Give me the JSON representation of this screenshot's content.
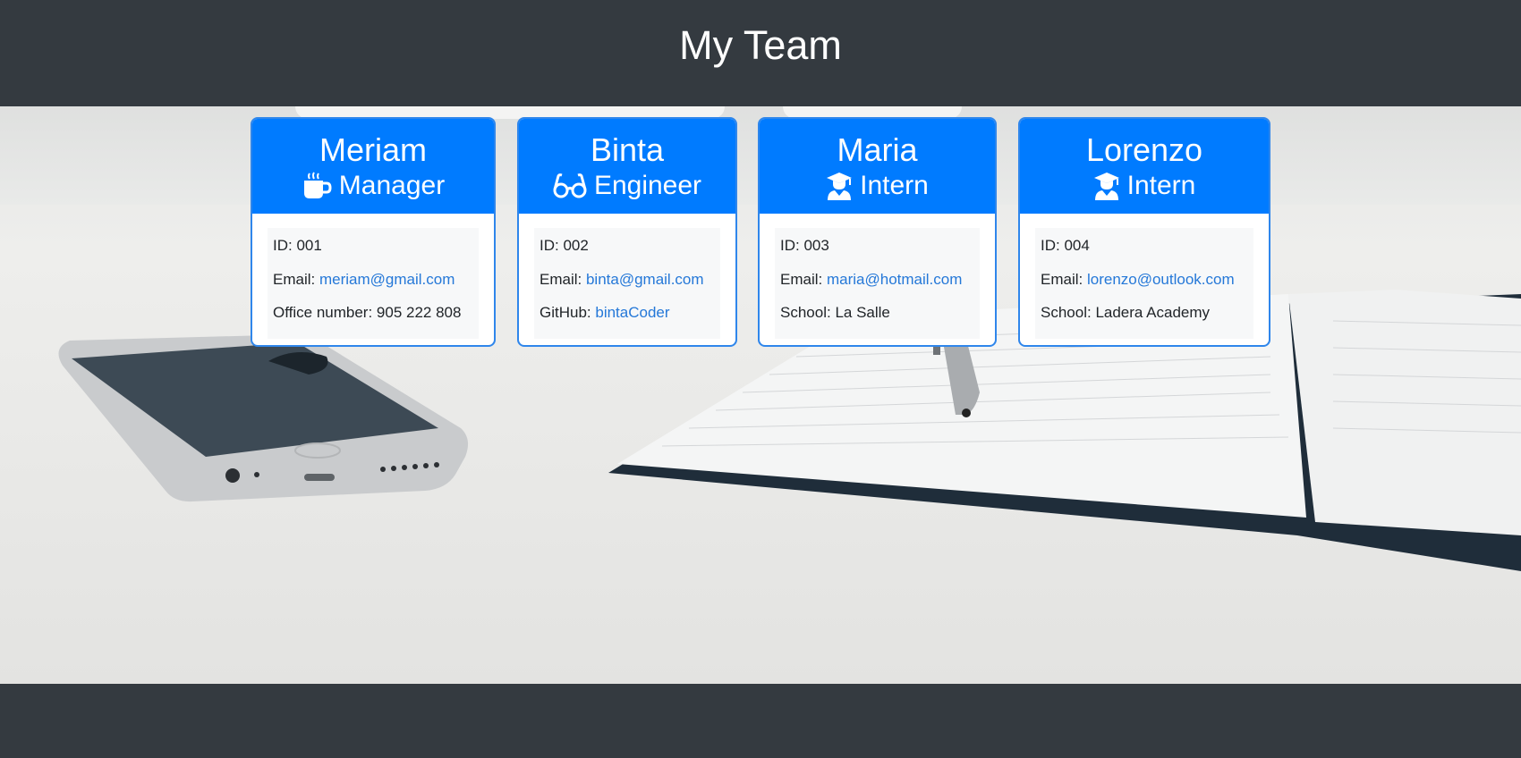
{
  "header": {
    "title": "My Team"
  },
  "colors": {
    "header_bg": "#343a40",
    "card_header": "#007bff",
    "link": "#2578d8"
  },
  "team": [
    {
      "name": "Meriam",
      "role": "Manager",
      "icon": "mug-icon",
      "id_label": "ID:",
      "id": "001",
      "email_label": "Email:",
      "email": "meriam@gmail.com",
      "extra_label": "Office number:",
      "extra": "905 222 808"
    },
    {
      "name": "Binta",
      "role": "Engineer",
      "icon": "glasses-icon",
      "id_label": "ID:",
      "id": "002",
      "email_label": "Email:",
      "email": "binta@gmail.com",
      "extra_label": "GitHub:",
      "extra": "bintaCoder"
    },
    {
      "name": "Maria",
      "role": "Intern",
      "icon": "graduate-icon",
      "id_label": "ID:",
      "id": "003",
      "email_label": "Email:",
      "email": "maria@hotmail.com",
      "extra_label": "School:",
      "extra": "La Salle"
    },
    {
      "name": "Lorenzo",
      "role": "Intern",
      "icon": "graduate-icon",
      "id_label": "ID:",
      "id": "004",
      "email_label": "Email:",
      "email": "lorenzo@outlook.com",
      "extra_label": "School:",
      "extra": "Ladera Academy"
    }
  ]
}
